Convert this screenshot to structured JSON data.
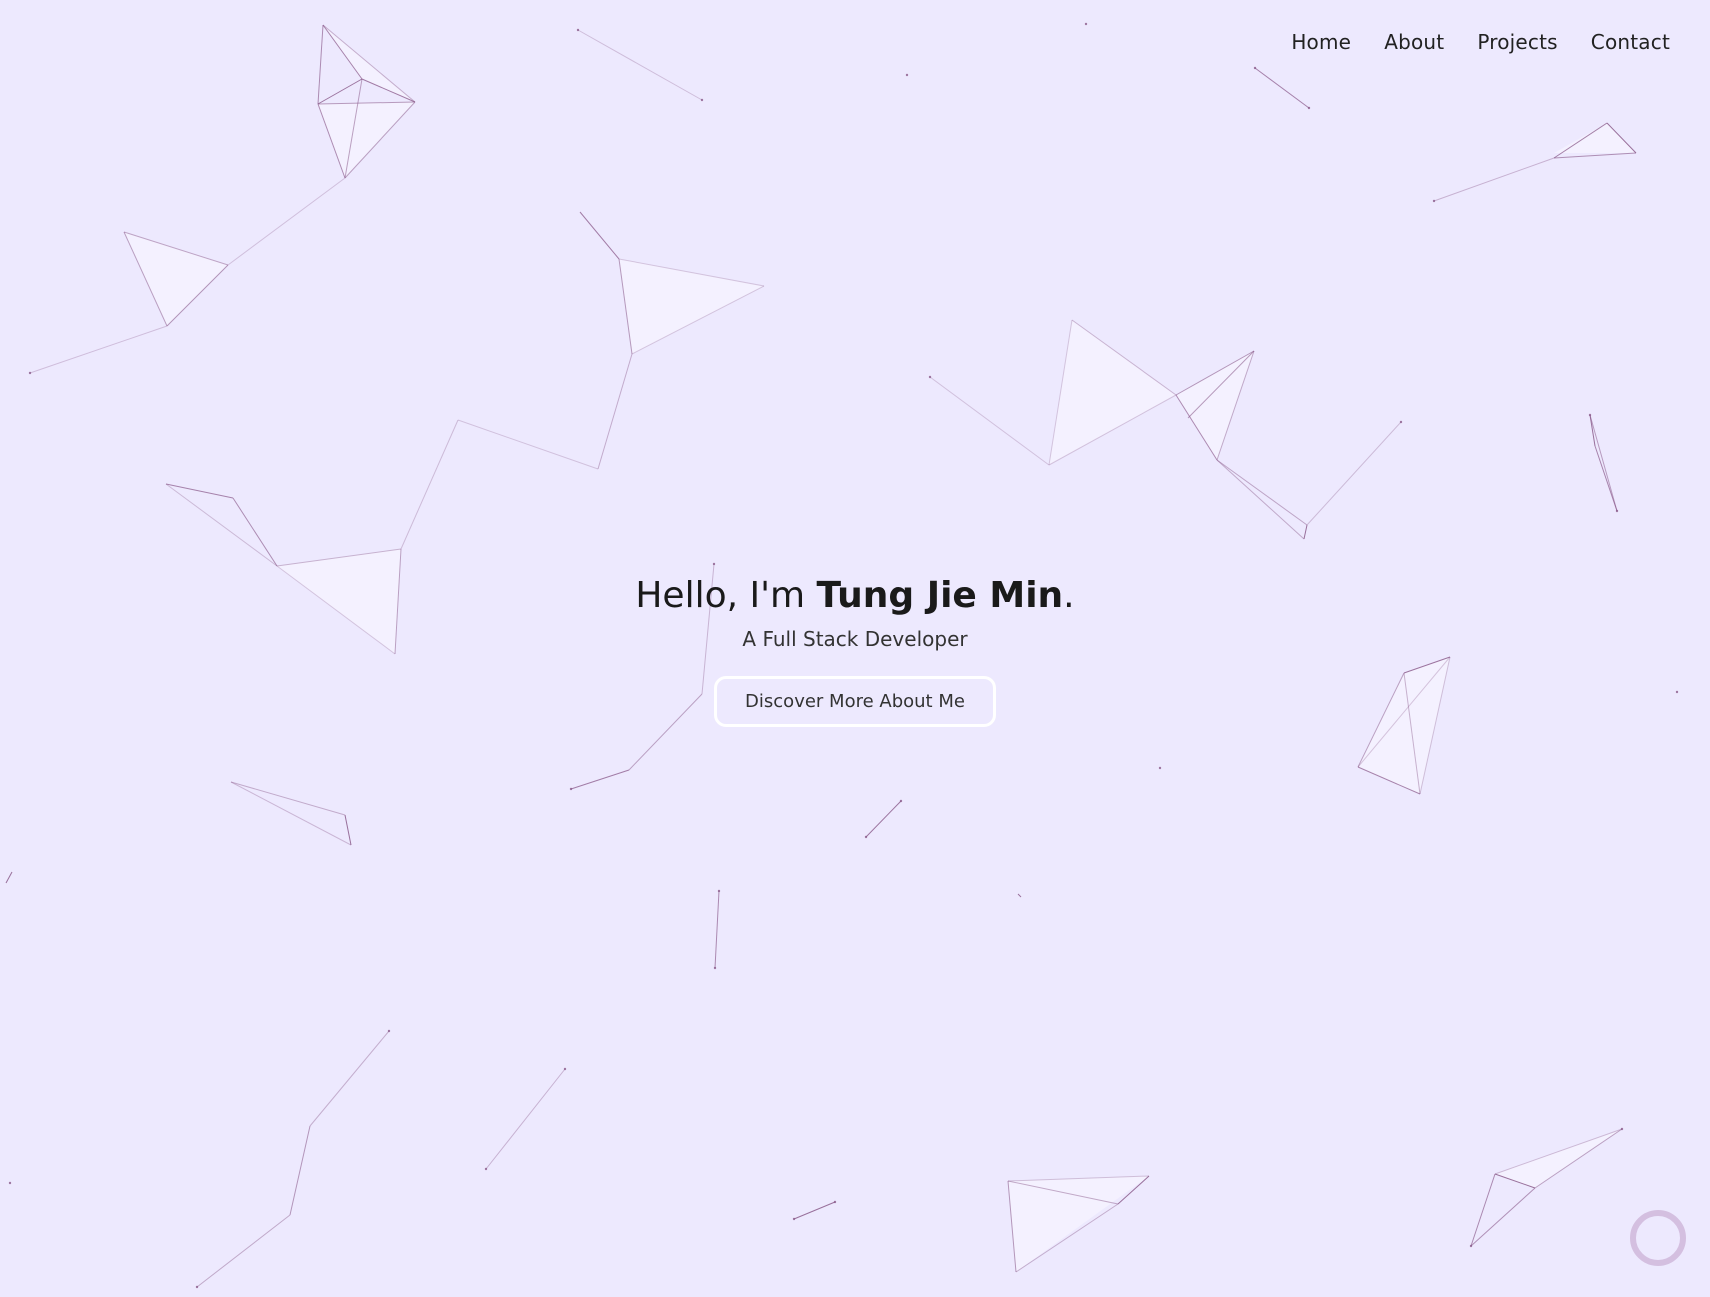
{
  "nav": {
    "items": [
      {
        "label": "Home",
        "name": "nav-home"
      },
      {
        "label": "About",
        "name": "nav-about"
      },
      {
        "label": "Projects",
        "name": "nav-projects"
      },
      {
        "label": "Contact",
        "name": "nav-contact"
      }
    ]
  },
  "hero": {
    "greeting": "Hello, I'm ",
    "name": "Tung Jie Min",
    "punctuation": ".",
    "subtitle": "A Full Stack Developer",
    "cta_label": "Discover More About Me"
  },
  "colors": {
    "background": "#ede9fe",
    "network_line": "#8a5a8a",
    "network_fill": "#f5f3ff",
    "button_border": "#ffffff",
    "ring": "#d4bfe0"
  }
}
